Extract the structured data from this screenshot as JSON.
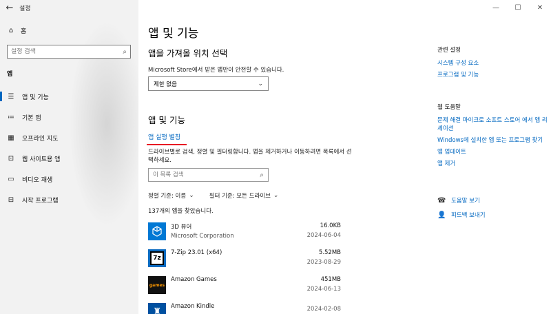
{
  "window": {
    "title": "설정",
    "back_glyph": "←",
    "minimize_glyph": "—",
    "maximize_glyph": "☐",
    "close_glyph": "✕"
  },
  "sidebar": {
    "home_label": "홈",
    "search_placeholder": "설정 검색",
    "section_label": "앱",
    "items": [
      {
        "label": "앱 및 기능",
        "icon": "apps-list-icon",
        "active": true
      },
      {
        "label": "기본 앱",
        "icon": "default-apps-icon",
        "active": false
      },
      {
        "label": "오프라인 지도",
        "icon": "offline-maps-icon",
        "active": false
      },
      {
        "label": "웹 사이트용 앱",
        "icon": "apps-for-websites-icon",
        "active": false
      },
      {
        "label": "비디오 재생",
        "icon": "video-playback-icon",
        "active": false
      },
      {
        "label": "시작 프로그램",
        "icon": "startup-icon",
        "active": false
      }
    ]
  },
  "main": {
    "page_title": "앱 및 기능",
    "install_section_title": "앱을 가져올 위치 선택",
    "install_desc": "Microsoft Store에서 받은 앱만이 안전할 수 있습니다.",
    "install_dropdown_value": "제한 없음",
    "apps_section_title": "앱 및 기능",
    "alias_link": "앱 실행 별칭",
    "list_desc": "드라이브별로 검색, 정렬 및 필터링합니다. 앱을 제거하거나 이동하려면 목록에서 선택하세요.",
    "list_search_placeholder": "이 목록 검색",
    "sort_label": "정렬 기준: 이름",
    "filter_label": "필터 기준: 모든 드라이브",
    "found_count": "137개의 앱을 찾았습니다.",
    "apps": [
      {
        "name": "3D 뷰어",
        "publisher": "Microsoft Corporation",
        "size": "16.0KB",
        "date": "2024-06-04",
        "icon": "3d-viewer-icon",
        "color": "#0078d4",
        "glyph": "⬡"
      },
      {
        "name": "7-Zip 23.01 (x64)",
        "publisher": "",
        "size": "5.52MB",
        "date": "2023-08-29",
        "icon": "7zip-icon",
        "color": "#0a6ac0",
        "glyph": "7z"
      },
      {
        "name": "Amazon Games",
        "publisher": "",
        "size": "451MB",
        "date": "2024-06-13",
        "icon": "amazon-games-icon",
        "color": "#111111",
        "glyph": "games"
      },
      {
        "name": "Amazon Kindle",
        "publisher": "",
        "size": "",
        "date": "2024-02-08",
        "icon": "amazon-kindle-icon",
        "color": "#0050a0",
        "glyph": "♜"
      }
    ]
  },
  "related": {
    "heading": "관련 설정",
    "links": [
      "시스템 구성 요소",
      "프로그램 및 기능"
    ]
  },
  "help": {
    "heading": "웹 도움말",
    "links": [
      "문제 해결 마이크로 소프트 스토어 에서 앱 리셰이션",
      "Windows에 설치한 앱 또는 프로그램 찾기",
      "앱 업데이트",
      "앱 제거"
    ]
  },
  "support": {
    "get_help": "도움말 보기",
    "feedback": "피드백 보내기"
  }
}
